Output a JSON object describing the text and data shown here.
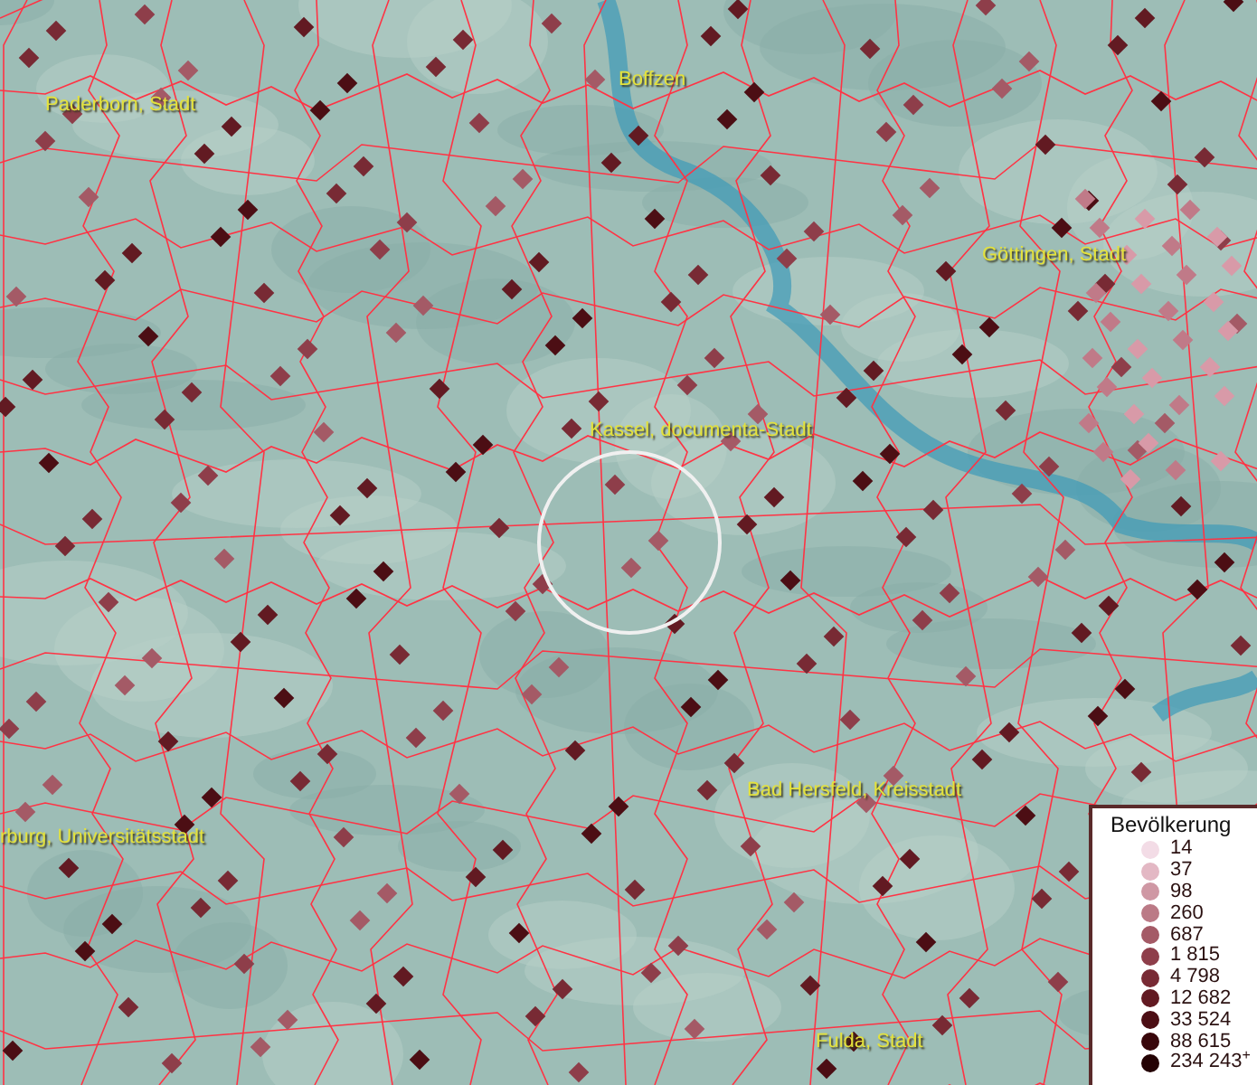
{
  "map": {
    "place_labels": [
      {
        "text": "Paderborn, Stadt"
      },
      {
        "text": "Boffzen"
      },
      {
        "text": "Göttingen, Stadt"
      },
      {
        "text": "Kassel, documenta-Stadt"
      },
      {
        "text": "Bad Hersfeld, Kreisstadt"
      },
      {
        "text": "rburg, Universitätsstadt"
      },
      {
        "text": "Fulda, Stadt"
      }
    ]
  },
  "legend": {
    "title": "Bevölkerung",
    "items": [
      {
        "label": "14",
        "color": "#f3dce6"
      },
      {
        "label": "37",
        "color": "#e3b8c4"
      },
      {
        "label": "98",
        "color": "#cf98a4"
      },
      {
        "label": "260",
        "color": "#bb7a86"
      },
      {
        "label": "687",
        "color": "#a45a66"
      },
      {
        "label": "1 815",
        "color": "#8e3e4a"
      },
      {
        "label": "4 798",
        "color": "#782a34"
      },
      {
        "label": "12 682",
        "color": "#621a22"
      },
      {
        "label": "33 524",
        "color": "#4c0e14"
      },
      {
        "label": "88 615",
        "color": "#38060a"
      },
      {
        "label": "234 243$^{+}$",
        "color": "#240204"
      }
    ]
  }
}
